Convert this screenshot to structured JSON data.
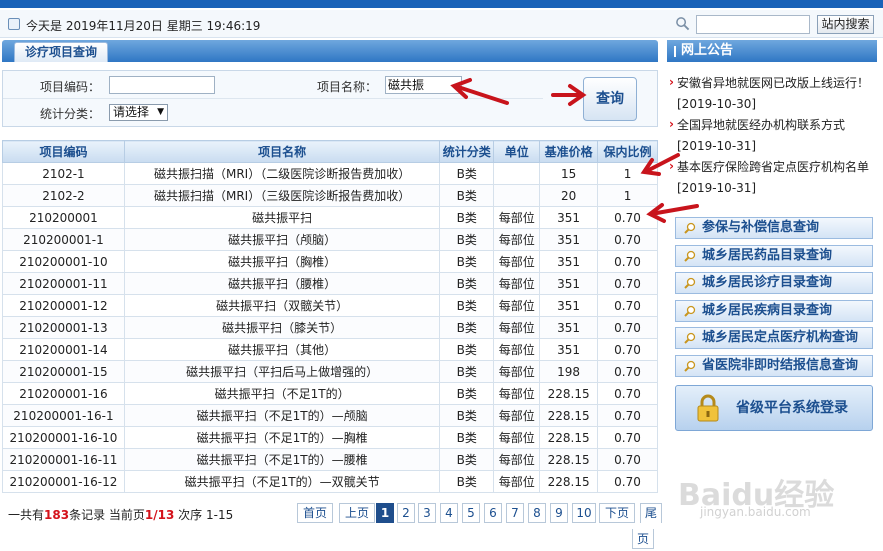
{
  "date_bar": {
    "date_text": "今天是 2019年11月20日    星期三   19:46:19",
    "search_button": "站内搜索",
    "search_icon": "search-icon"
  },
  "panel": {
    "title": "诊疗项目查询"
  },
  "query": {
    "code_label": "项目编码：",
    "code_value": "",
    "name_label": "项目名称：",
    "name_value": "磁共振",
    "category_label": "统计分类：",
    "category_value": "请选择",
    "search_label": "查询"
  },
  "table": {
    "headers": [
      "项目编码",
      "项目名称",
      "统计分类",
      "单位",
      "基准价格",
      "保内比例"
    ],
    "rows": [
      {
        "code": "2102-1",
        "name": "磁共振扫描（MRI）（二级医院诊断报告费加收）",
        "cat": "B类",
        "unit": "",
        "price": "15",
        "ratio": "1"
      },
      {
        "code": "2102-2",
        "name": "磁共振扫描（MRI）（三级医院诊断报告费加收）",
        "cat": "B类",
        "unit": "",
        "price": "20",
        "ratio": "1"
      },
      {
        "code": "210200001",
        "name": "磁共振平扫",
        "cat": "B类",
        "unit": "每部位",
        "price": "351",
        "ratio": "0.70"
      },
      {
        "code": "210200001-1",
        "name": "磁共振平扫（颅脑）",
        "cat": "B类",
        "unit": "每部位",
        "price": "351",
        "ratio": "0.70"
      },
      {
        "code": "210200001-10",
        "name": "磁共振平扫（胸椎）",
        "cat": "B类",
        "unit": "每部位",
        "price": "351",
        "ratio": "0.70"
      },
      {
        "code": "210200001-11",
        "name": "磁共振平扫（腰椎）",
        "cat": "B类",
        "unit": "每部位",
        "price": "351",
        "ratio": "0.70"
      },
      {
        "code": "210200001-12",
        "name": "磁共振平扫（双髋关节）",
        "cat": "B类",
        "unit": "每部位",
        "price": "351",
        "ratio": "0.70"
      },
      {
        "code": "210200001-13",
        "name": "磁共振平扫（膝关节）",
        "cat": "B类",
        "unit": "每部位",
        "price": "351",
        "ratio": "0.70"
      },
      {
        "code": "210200001-14",
        "name": "磁共振平扫（其他）",
        "cat": "B类",
        "unit": "每部位",
        "price": "351",
        "ratio": "0.70"
      },
      {
        "code": "210200001-15",
        "name": "磁共振平扫（平扫后马上做增强的）",
        "cat": "B类",
        "unit": "每部位",
        "price": "198",
        "ratio": "0.70"
      },
      {
        "code": "210200001-16",
        "name": "磁共振平扫（不足1T的）",
        "cat": "B类",
        "unit": "每部位",
        "price": "228.15",
        "ratio": "0.70"
      },
      {
        "code": "210200001-16-1",
        "name": "磁共振平扫（不足1T的）—颅脑",
        "cat": "B类",
        "unit": "每部位",
        "price": "228.15",
        "ratio": "0.70"
      },
      {
        "code": "210200001-16-10",
        "name": "磁共振平扫（不足1T的）—胸椎",
        "cat": "B类",
        "unit": "每部位",
        "price": "228.15",
        "ratio": "0.70"
      },
      {
        "code": "210200001-16-11",
        "name": "磁共振平扫（不足1T的）—腰椎",
        "cat": "B类",
        "unit": "每部位",
        "price": "228.15",
        "ratio": "0.70"
      },
      {
        "code": "210200001-16-12",
        "name": "磁共振平扫（不足1T的）—双髋关节",
        "cat": "B类",
        "unit": "每部位",
        "price": "228.15",
        "ratio": "0.70"
      }
    ]
  },
  "pager": {
    "prefix": "一共有",
    "total": "183",
    "mid": "条记录  当前页",
    "current": "1/13",
    "order": "  次序 1-15",
    "first": "首页",
    "prev": "上页",
    "pages": [
      "1",
      "2",
      "3",
      "4",
      "5",
      "6",
      "7",
      "8",
      "9",
      "10"
    ],
    "next": "下页",
    "last_top": "尾",
    "last_bottom": "页"
  },
  "sidebar": {
    "title": "网上公告",
    "notices": [
      "安徽省异地就医网已改版上线运行！ [2019-10-30]",
      "全国异地就医经办机构联系方式 [2019-10-31]",
      "基本医疗保险跨省定点医疗机构名单 [2019-10-31]"
    ],
    "buttons": [
      "参保与补偿信息查询",
      "城乡居民药品目录查询",
      "城乡居民诊疗目录查询",
      "城乡居民疾病目录查询",
      "城乡居民定点医疗机构查询",
      "省医院非即时结报信息查询"
    ],
    "login": "省级平台系统登录"
  },
  "watermark": {
    "text": "Baidu经验",
    "sub": "jingyan.baidu.com"
  },
  "colors": {
    "brand_blue": "#2f77c4",
    "annotation_red": "#c8141c",
    "highlight_red": "#d4121b"
  }
}
